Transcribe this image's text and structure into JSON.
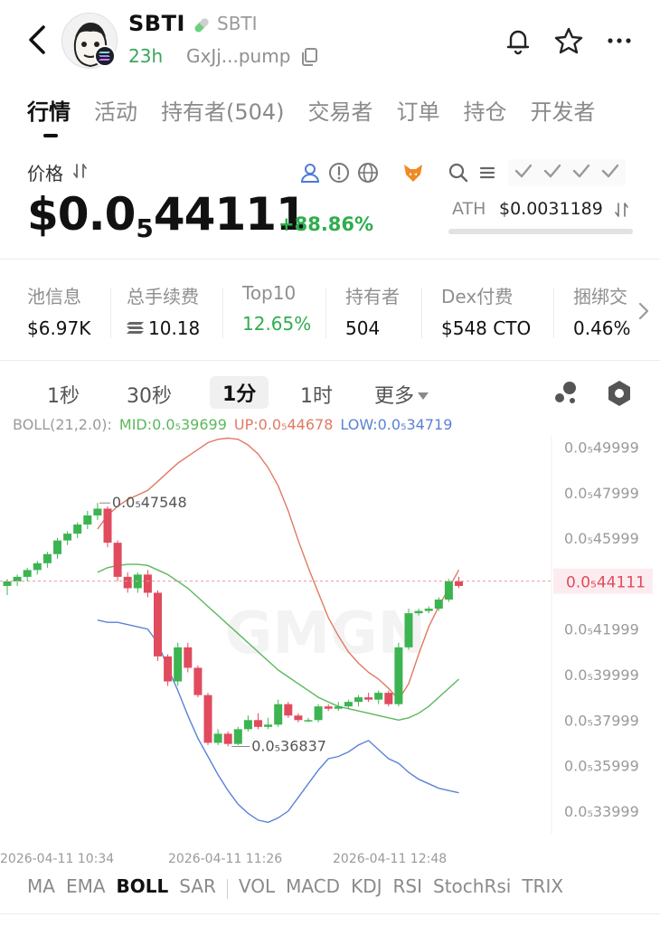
{
  "header": {
    "symbol": "SBTI",
    "name": "SBTI",
    "age": "23h",
    "address": "GxJj...pump"
  },
  "tabs": [
    "行情",
    "活动",
    "持有者(504)",
    "交易者",
    "订单",
    "持仓",
    "开发者"
  ],
  "price": {
    "label": "价格",
    "main_prefix": "$0.0",
    "main_zeros": "5",
    "main_digits": "44111",
    "change": "+88.86%",
    "ath_label": "ATH",
    "ath_value": "$0.0031189"
  },
  "stats": [
    {
      "label": "池信息",
      "value": "$6.97K"
    },
    {
      "label": "总手续费",
      "value": "10.18",
      "icon": "solana-icon"
    },
    {
      "label": "Top10",
      "value": "12.65%",
      "status": "green"
    },
    {
      "label": "持有者",
      "value": "504"
    },
    {
      "label": "Dex付费",
      "value": "$548 CTO"
    },
    {
      "label": "捆绑交",
      "value": "0.46%"
    }
  ],
  "intervals": [
    "1秒",
    "30秒",
    "1分",
    "1时",
    "更多"
  ],
  "boll": {
    "params": "BOLL(21,2.0):",
    "mid": "MID:0.0₅39699",
    "up": "UP:0.0₅44678",
    "low": "LOW:0.0₅34719"
  },
  "chart_data": {
    "type": "candlestick",
    "y_tick_labels": [
      "0.0₅49999",
      "0.0₅47999",
      "0.0₅45999",
      "0.0₅43999",
      "0.0₅41999",
      "0.0₅39999",
      "0.0₅37999",
      "0.0₅35999",
      "0.0₅33999"
    ],
    "current_price_label": "0.0₅44111",
    "max_annotation": "0.0₅47548",
    "min_annotation": "0.0₅36837",
    "x_tick_labels": [
      "2026-04-11 10:34",
      "2026-04-11 11:26",
      "2026-04-11 12:48"
    ],
    "watermark": "GMGN",
    "unit_note": "prices in units of 1e-5 USD",
    "y_range": [
      33.0,
      50.5
    ],
    "candles": [
      {
        "o": 43.9,
        "h": 44.2,
        "l": 43.5,
        "c": 44.1
      },
      {
        "o": 44.1,
        "h": 44.4,
        "l": 43.9,
        "c": 44.3
      },
      {
        "o": 44.3,
        "h": 44.7,
        "l": 44.1,
        "c": 44.6
      },
      {
        "o": 44.6,
        "h": 45.0,
        "l": 44.4,
        "c": 44.9
      },
      {
        "o": 44.9,
        "h": 45.4,
        "l": 44.7,
        "c": 45.3
      },
      {
        "o": 45.3,
        "h": 46.0,
        "l": 45.1,
        "c": 45.9
      },
      {
        "o": 45.9,
        "h": 46.3,
        "l": 45.7,
        "c": 46.2
      },
      {
        "o": 46.2,
        "h": 46.7,
        "l": 46.0,
        "c": 46.6
      },
      {
        "o": 46.6,
        "h": 47.2,
        "l": 46.4,
        "c": 47.0
      },
      {
        "o": 47.0,
        "h": 47.55,
        "l": 46.8,
        "c": 47.3
      },
      {
        "o": 47.3,
        "h": 47.4,
        "l": 45.6,
        "c": 45.8
      },
      {
        "o": 45.8,
        "h": 45.9,
        "l": 44.1,
        "c": 44.3
      },
      {
        "o": 44.3,
        "h": 44.5,
        "l": 43.6,
        "c": 43.8
      },
      {
        "o": 43.8,
        "h": 44.5,
        "l": 43.6,
        "c": 44.4
      },
      {
        "o": 44.4,
        "h": 44.6,
        "l": 43.4,
        "c": 43.6
      },
      {
        "o": 43.6,
        "h": 43.7,
        "l": 40.6,
        "c": 40.8
      },
      {
        "o": 40.8,
        "h": 40.9,
        "l": 39.5,
        "c": 39.7
      },
      {
        "o": 39.7,
        "h": 41.4,
        "l": 39.5,
        "c": 41.2
      },
      {
        "o": 41.2,
        "h": 41.4,
        "l": 40.1,
        "c": 40.3
      },
      {
        "o": 40.3,
        "h": 40.4,
        "l": 39.0,
        "c": 39.1
      },
      {
        "o": 39.1,
        "h": 39.2,
        "l": 36.9,
        "c": 37.0
      },
      {
        "o": 37.0,
        "h": 37.6,
        "l": 36.9,
        "c": 37.4
      },
      {
        "o": 37.4,
        "h": 37.5,
        "l": 36.84,
        "c": 36.95
      },
      {
        "o": 36.95,
        "h": 37.7,
        "l": 36.9,
        "c": 37.6
      },
      {
        "o": 37.6,
        "h": 38.2,
        "l": 37.5,
        "c": 38.0
      },
      {
        "o": 38.0,
        "h": 38.3,
        "l": 37.6,
        "c": 37.7
      },
      {
        "o": 37.7,
        "h": 38.1,
        "l": 37.6,
        "c": 37.8
      },
      {
        "o": 37.8,
        "h": 38.9,
        "l": 37.7,
        "c": 38.7
      },
      {
        "o": 38.7,
        "h": 38.8,
        "l": 38.1,
        "c": 38.2
      },
      {
        "o": 38.2,
        "h": 38.3,
        "l": 37.9,
        "c": 38.0
      },
      {
        "o": 38.0,
        "h": 38.1,
        "l": 37.9,
        "c": 38.0
      },
      {
        "o": 38.0,
        "h": 38.7,
        "l": 37.9,
        "c": 38.6
      },
      {
        "o": 38.6,
        "h": 38.7,
        "l": 38.4,
        "c": 38.5
      },
      {
        "o": 38.5,
        "h": 38.8,
        "l": 38.4,
        "c": 38.6
      },
      {
        "o": 38.6,
        "h": 38.9,
        "l": 38.5,
        "c": 38.8
      },
      {
        "o": 38.8,
        "h": 39.1,
        "l": 38.6,
        "c": 39.0
      },
      {
        "o": 39.0,
        "h": 39.2,
        "l": 38.8,
        "c": 38.9
      },
      {
        "o": 38.9,
        "h": 39.3,
        "l": 38.7,
        "c": 39.2
      },
      {
        "o": 39.2,
        "h": 39.3,
        "l": 38.6,
        "c": 38.7
      },
      {
        "o": 38.7,
        "h": 41.4,
        "l": 38.6,
        "c": 41.2
      },
      {
        "o": 41.2,
        "h": 42.9,
        "l": 41.1,
        "c": 42.7
      },
      {
        "o": 42.7,
        "h": 42.9,
        "l": 42.6,
        "c": 42.8
      },
      {
        "o": 42.8,
        "h": 43.0,
        "l": 42.7,
        "c": 42.9
      },
      {
        "o": 42.9,
        "h": 43.4,
        "l": 42.8,
        "c": 43.3
      },
      {
        "o": 43.3,
        "h": 44.2,
        "l": 43.2,
        "c": 44.1
      },
      {
        "o": 44.1,
        "h": 44.3,
        "l": 43.8,
        "c": 43.9
      }
    ],
    "boll_up": [
      null,
      null,
      null,
      null,
      null,
      null,
      null,
      null,
      null,
      46.4,
      47.0,
      47.4,
      47.7,
      47.9,
      48.1,
      48.5,
      48.9,
      49.3,
      49.6,
      49.9,
      50.2,
      50.35,
      50.4,
      50.35,
      50.1,
      49.7,
      49.1,
      48.3,
      47.2,
      45.9,
      44.7,
      43.6,
      42.5,
      41.7,
      41.0,
      40.5,
      40.1,
      39.8,
      39.4,
      38.9,
      39.6,
      40.9,
      42.1,
      43.0,
      43.8,
      44.6
    ],
    "boll_mid": [
      null,
      null,
      null,
      null,
      null,
      null,
      null,
      null,
      null,
      44.5,
      44.7,
      44.8,
      44.85,
      44.85,
      44.8,
      44.6,
      44.4,
      44.1,
      43.8,
      43.4,
      43.0,
      42.6,
      42.2,
      41.8,
      41.4,
      41.0,
      40.6,
      40.2,
      39.9,
      39.6,
      39.3,
      39.0,
      38.8,
      38.6,
      38.5,
      38.4,
      38.3,
      38.2,
      38.1,
      38.0,
      38.1,
      38.3,
      38.6,
      39.0,
      39.4,
      39.8
    ],
    "boll_low": [
      null,
      null,
      null,
      null,
      null,
      null,
      null,
      null,
      null,
      42.4,
      42.3,
      42.3,
      42.2,
      42.1,
      42.0,
      41.4,
      40.3,
      39.3,
      38.2,
      37.2,
      36.4,
      35.6,
      34.9,
      34.3,
      33.9,
      33.6,
      33.5,
      33.7,
      34.0,
      34.6,
      35.2,
      35.8,
      36.3,
      36.4,
      36.6,
      36.9,
      37.1,
      36.7,
      36.3,
      36.1,
      35.7,
      35.4,
      35.2,
      35.0,
      34.9,
      34.8
    ]
  },
  "indicators": [
    "MA",
    "EMA",
    "BOLL",
    "SAR",
    "VOL",
    "MACD",
    "KDJ",
    "RSI",
    "StochRsi",
    "TRIX"
  ],
  "colors": {
    "up": "#3cb451",
    "down": "#e04b5e",
    "boll_up": "#e07a63",
    "boll_mid": "#5bb85c",
    "boll_low": "#5b82d6",
    "accent_green": "#2fae4e"
  }
}
